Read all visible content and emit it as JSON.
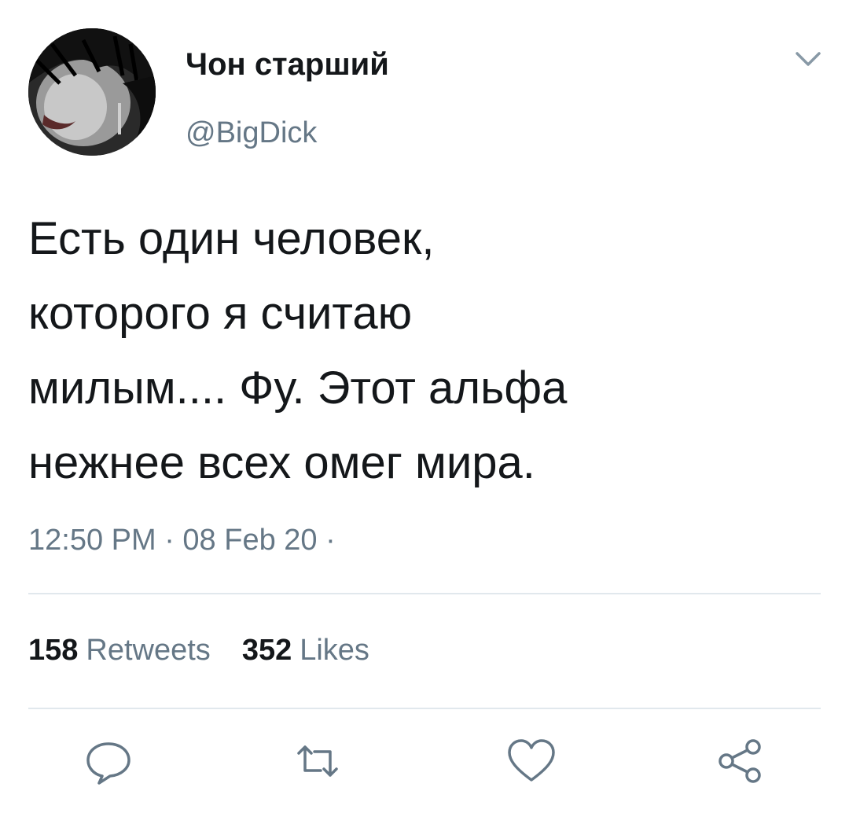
{
  "tweet": {
    "display_name": "Чон старший",
    "handle": "@BigDick",
    "text": "Есть один человек,\nкоторого я считаю\nмилым.... Фу. Этот альфа\nнежнее всех омег мира.",
    "timestamp": "12:50 PM · 08 Feb 20 ·"
  },
  "stats": {
    "retweets_count": "158",
    "retweets_label": "Retweets",
    "likes_count": "352",
    "likes_label": "Likes"
  },
  "icons": {
    "caret": "chevron-down-icon",
    "reply": "reply-icon",
    "retweet": "retweet-icon",
    "like": "heart-icon",
    "share": "share-icon"
  },
  "colors": {
    "text": "#14171a",
    "secondary": "#657786",
    "divider": "#e1e8ed"
  }
}
